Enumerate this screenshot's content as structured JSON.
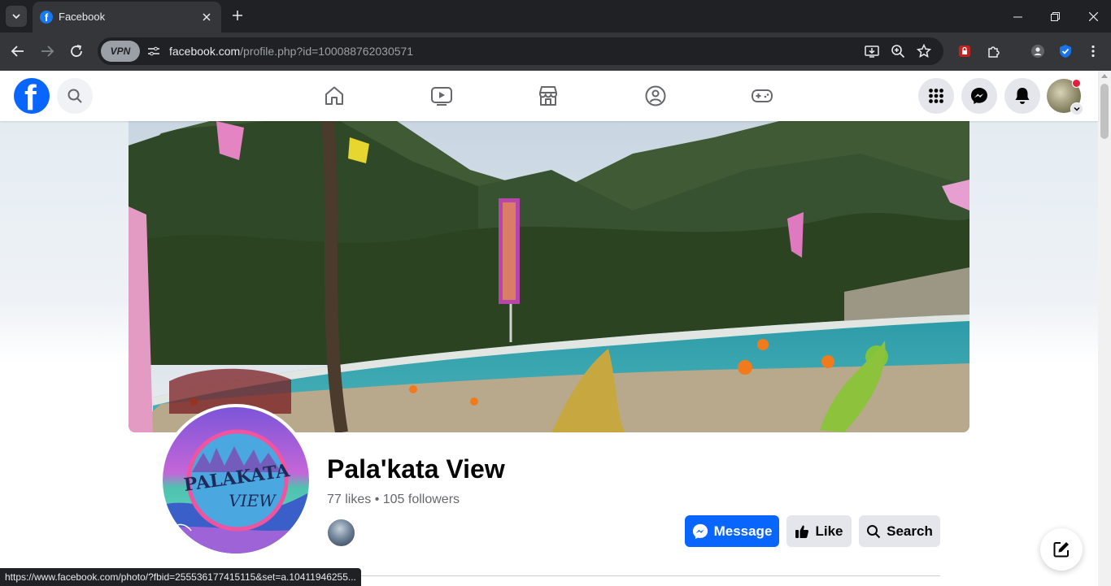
{
  "browser": {
    "tab_title": "Facebook",
    "url_host": "facebook.com",
    "url_path": "/profile.php?id=100088762030571",
    "vpn_label": "VPN",
    "status_url": "https://www.facebook.com/photo/?fbid=255536177415115&set=a.10411946255..."
  },
  "fb": {
    "logo_letter": "f"
  },
  "profile": {
    "name": "Pala'kata View",
    "stats": "77 likes • 105 followers",
    "logo_text_top": "PALAKATA",
    "logo_text_bottom": "VIEW"
  },
  "actions": {
    "message_label": "Message",
    "like_label": "Like",
    "search_label": "Search"
  },
  "colors": {
    "fb_blue": "#0866ff",
    "browser_dark": "#202124",
    "notification_red": "#e41e3f"
  }
}
